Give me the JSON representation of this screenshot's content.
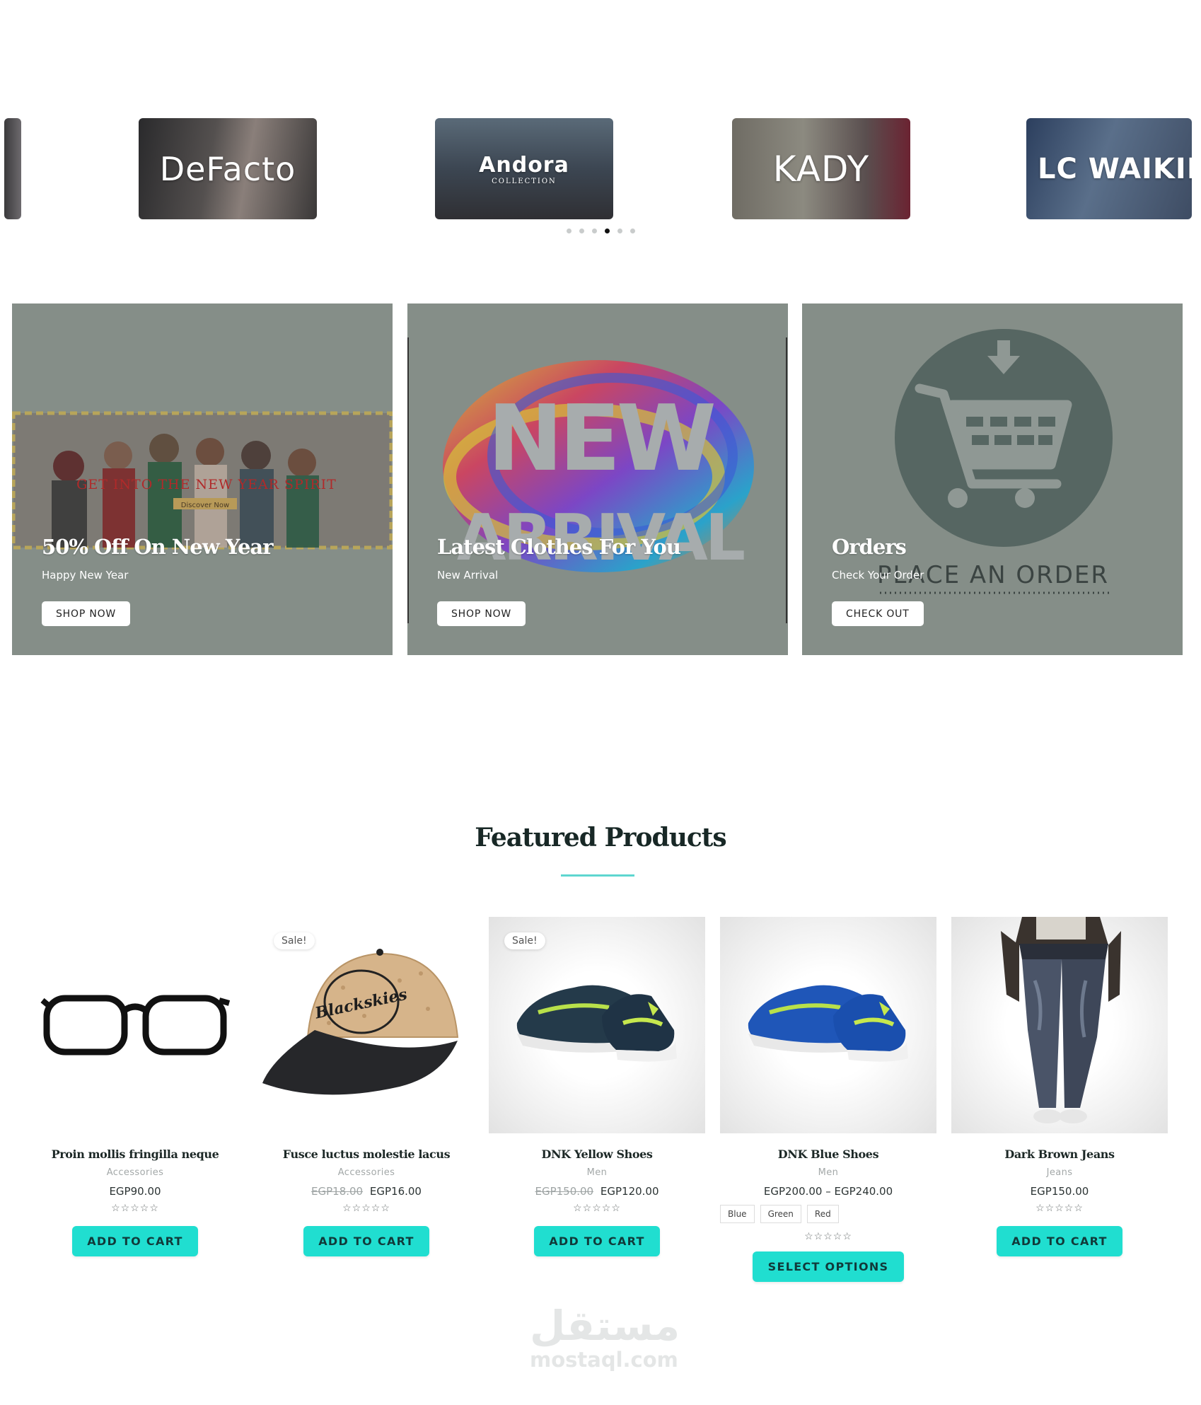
{
  "brands": {
    "items": [
      {
        "name": "DeFacto"
      },
      {
        "name": "Andora",
        "sub": "COLLECTION"
      },
      {
        "name": "KADY"
      },
      {
        "name": "LC WAIKIKI"
      }
    ],
    "slide_count": 6,
    "active_slide": 4
  },
  "banners": [
    {
      "art_text": "GET INTO THE NEW YEAR SPIRIT",
      "art_sub": "Discover Now",
      "title": "50% Off On New Year",
      "subtitle": "Happy New Year",
      "button": "SHOP NOW"
    },
    {
      "art_text_1": "NEW",
      "art_text_2": "ARRIVAL",
      "title": "Latest Clothes For You",
      "subtitle": "New Arrival",
      "button": "SHOP NOW"
    },
    {
      "art_text": "PLACE AN ORDER",
      "title": "Orders",
      "subtitle": "Check Your Order",
      "button": "CHECK OUT"
    }
  ],
  "featured": {
    "title": "Featured Products",
    "products": [
      {
        "name": "Proin mollis fringilla neque",
        "category": "Accessories",
        "price": "EGP90.00",
        "button": "ADD TO CART"
      },
      {
        "name": "Fusce luctus molestie lacus",
        "category": "Accessories",
        "old_price": "EGP18.00",
        "price": "EGP16.00",
        "sale": "Sale!",
        "cap_text": "Blackskies",
        "button": "ADD TO CART"
      },
      {
        "name": "DNK Yellow Shoes",
        "category": "Men",
        "old_price": "EGP150.00",
        "price": "EGP120.00",
        "sale": "Sale!",
        "button": "ADD TO CART"
      },
      {
        "name": "DNK Blue Shoes",
        "category": "Men",
        "price": "EGP200.00 – EGP240.00",
        "swatches": [
          "Blue",
          "Green",
          "Red"
        ],
        "button": "SELECT OPTIONS"
      },
      {
        "name": "Dark Brown Jeans",
        "category": "Jeans",
        "price": "EGP150.00",
        "button": "ADD TO CART"
      }
    ],
    "rating_stars": "☆☆☆☆☆"
  },
  "watermark": {
    "arabic": "مستقل",
    "latin": "mostaql.com"
  },
  "colors": {
    "accent": "#20ded0",
    "banner_overlay": "#858e88",
    "underline": "#5ed6d0"
  }
}
